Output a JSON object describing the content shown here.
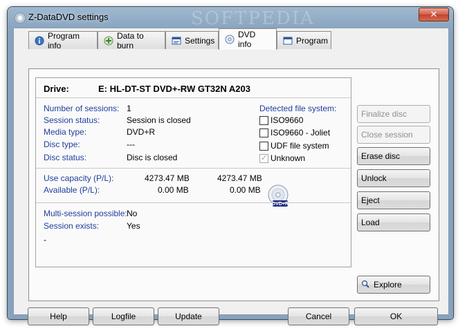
{
  "window": {
    "title": "Z-DataDVD settings",
    "watermark": "SOFTPEDIA",
    "close_glyph": "✕"
  },
  "tabs": [
    {
      "label": "Program info",
      "icon": "info-icon"
    },
    {
      "label": "Data to burn",
      "icon": "add-data-icon"
    },
    {
      "label": "Settings",
      "icon": "settings-window-icon"
    },
    {
      "label": "DVD info",
      "icon": "dvd-icon",
      "active": true
    },
    {
      "label": "Program",
      "icon": "program-window-icon"
    }
  ],
  "drive": {
    "label": "Drive:",
    "value": "E: HL-DT-ST DVD+-RW GT32N A203"
  },
  "info": {
    "sessions_label": "Number of sessions:",
    "sessions_value": "1",
    "session_status_label": "Session status:",
    "session_status_value": "Session is closed",
    "media_type_label": "Media type:",
    "media_type_value": "DVD+R",
    "disc_type_label": "Disc type:",
    "disc_type_value": "---",
    "disc_status_label": "Disc status:",
    "disc_status_value": "Disc is closed"
  },
  "filesystem": {
    "title": "Detected file system:",
    "options": [
      {
        "label": "ISO9660",
        "checked": false
      },
      {
        "label": "ISO9660 - Joliet",
        "checked": false
      },
      {
        "label": "UDF file system",
        "checked": false
      },
      {
        "label": "Unknown",
        "checked": true
      }
    ]
  },
  "capacity": {
    "use_label": "Use capacity (P/L):",
    "use_p": "4273.47 MB",
    "use_l": "4273.47 MB",
    "avail_label": "Available (P/L):",
    "avail_p": "0.00 MB",
    "avail_l": "0.00 MB",
    "disc_badge": "DVD+R"
  },
  "multisession": {
    "possible_label": "Multi-session possible:",
    "possible_value": "No",
    "exists_label": "Session exists:",
    "exists_value": "Yes",
    "extra": "-"
  },
  "side_buttons": {
    "finalize": "Finalize disc",
    "close_session": "Close session",
    "erase": "Erase disc",
    "unlock": "Unlock",
    "eject": "Eject",
    "load": "Load",
    "explore": "Explore"
  },
  "bottom_buttons": {
    "help": "Help",
    "logfile": "Logfile",
    "update": "Update",
    "cancel": "Cancel",
    "ok": "OK"
  },
  "colors": {
    "label_blue": "#1e3f9c",
    "frame": "#8aa6c0"
  }
}
